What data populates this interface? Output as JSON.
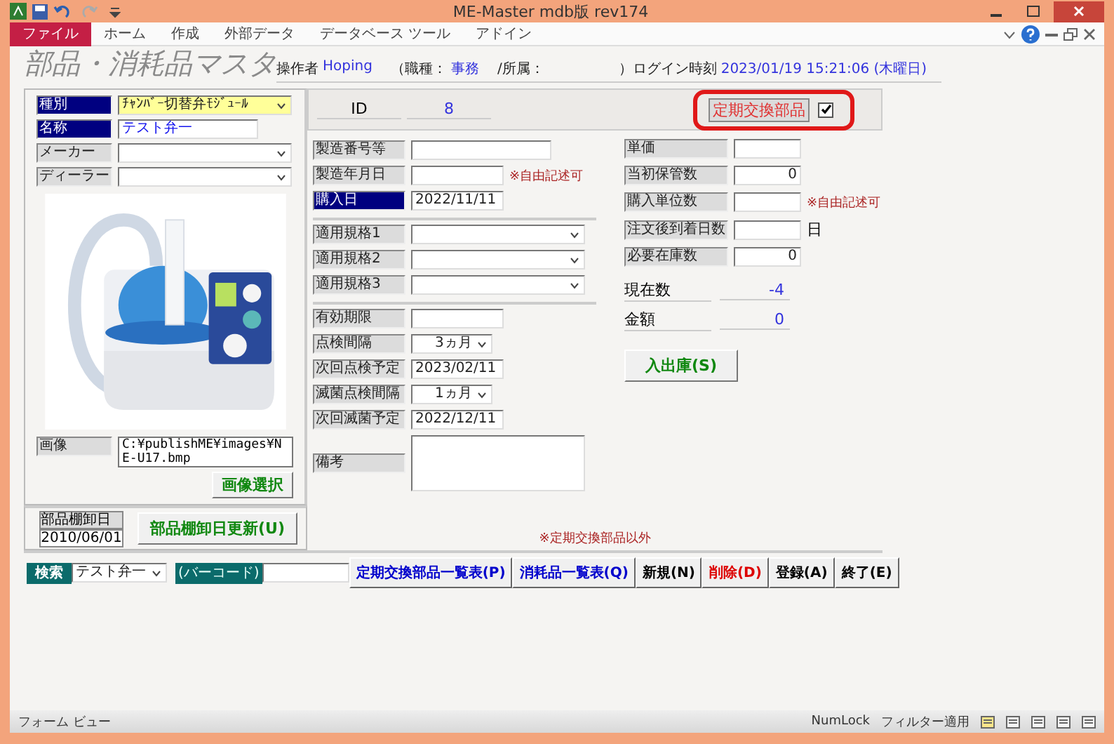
{
  "window": {
    "title": "ME-Master mdb版 rev174"
  },
  "ribbon_tabs": [
    {
      "label": "ファイル",
      "selected": true
    },
    {
      "label": "ホーム",
      "selected": false
    },
    {
      "label": "作成",
      "selected": false
    },
    {
      "label": "外部データ",
      "selected": false
    },
    {
      "label": "データベース ツール",
      "selected": false
    },
    {
      "label": "アドイン",
      "selected": false
    }
  ],
  "form": {
    "title": "部品・消耗品マスタ",
    "header": [
      {
        "label": "操作者",
        "value": "Hoping"
      },
      {
        "label": "（職種：",
        "value": "事務"
      },
      {
        "label": "/所属："
      },
      {
        "label": "）ログイン時刻",
        "value": "2023/01/19 15:21:06 (木曜日)"
      }
    ],
    "left_fields": [
      {
        "kind": "combo",
        "label": "種別",
        "required": true,
        "highlighted": true,
        "value": "ﾁｬﾝﾊﾞｰ切替弁ﾓｼﾞｭｰﾙ"
      },
      {
        "kind": "text",
        "label": "名称",
        "required": true,
        "highlighted": false,
        "value": "テスト弁一"
      },
      {
        "kind": "combo",
        "label": "メーカー",
        "required": false,
        "highlighted": false
      },
      {
        "kind": "combo",
        "label": "ディーラー",
        "required": false,
        "highlighted": false
      }
    ],
    "image": {
      "kind": "picture",
      "label": "画像",
      "path": "C:¥publishME¥images¥NE-U17.bmp",
      "button": "画像選択"
    },
    "id": {
      "label": "ID",
      "value": "8"
    },
    "middle_groups": [
      [
        {
          "kind": "text",
          "label": "製造番号等",
          "required": false
        },
        {
          "kind": "date",
          "label": "製造年月日",
          "required": false,
          "note": "※自由記述可"
        },
        {
          "kind": "date",
          "label": "購入日",
          "required": true,
          "value": "2022/11/11"
        }
      ],
      [
        {
          "kind": "combo",
          "label": "適用規格1",
          "required": false
        },
        {
          "kind": "combo",
          "label": "適用規格2",
          "required": false
        },
        {
          "kind": "combo",
          "label": "適用規格3",
          "required": false
        }
      ],
      [
        {
          "kind": "date",
          "label": "有効期限",
          "required": false
        },
        {
          "kind": "interval",
          "label": "点検間隔",
          "required": false,
          "value": "3ヵ月"
        },
        {
          "kind": "date",
          "label": "次回点検予定",
          "required": false,
          "value": "2023/02/11"
        },
        {
          "kind": "interval",
          "label": "滅菌点検間隔",
          "required": false,
          "value": "1ヵ月"
        },
        {
          "kind": "date",
          "label": "次回滅菌予定",
          "required": false,
          "value": "2022/12/11"
        },
        {
          "kind": "memo",
          "label": "備考",
          "required": false
        }
      ]
    ],
    "periodic_part": {
      "label": "定期交換部品",
      "checked": true,
      "highlighted": true
    },
    "right_fields": [
      {
        "kind": "number",
        "label": "単価"
      },
      {
        "kind": "number",
        "label": "当初保管数",
        "value": "0"
      },
      {
        "kind": "number",
        "label": "購入単位数",
        "note": "※自由記述可"
      },
      {
        "kind": "number",
        "label": "注文後到着日数",
        "suffix": "日"
      },
      {
        "kind": "number",
        "label": "必要在庫数",
        "value": "0"
      },
      {
        "kind": "display",
        "label": "現在数",
        "value": "-4"
      },
      {
        "kind": "display",
        "label": "金額",
        "value": "0"
      }
    ],
    "stock_button": "入出庫(S)",
    "inventory": {
      "label": "部品棚卸日",
      "value": "2010/06/01",
      "button": "部品棚卸日更新(U)"
    },
    "footnote": "※定期交換部品以外",
    "toolbar": {
      "search_label": "検索",
      "search_value": "テスト弁一",
      "barcode_label": "(バーコード)",
      "buttons": [
        {
          "label": "定期交換部品一覧表(P)",
          "color": "#0000cc"
        },
        {
          "label": "消耗品一覧表(Q)",
          "color": "#0000cc"
        },
        {
          "label": "新規(N)",
          "color": "#000000"
        },
        {
          "label": "削除(D)",
          "color": "#dd0000"
        },
        {
          "label": "登録(A)",
          "color": "#000000"
        },
        {
          "label": "終了(E)",
          "color": "#000000"
        }
      ]
    }
  },
  "status_bar": {
    "view": "フォーム ビュー",
    "items": [
      "NumLock",
      "フィルター適用"
    ]
  }
}
